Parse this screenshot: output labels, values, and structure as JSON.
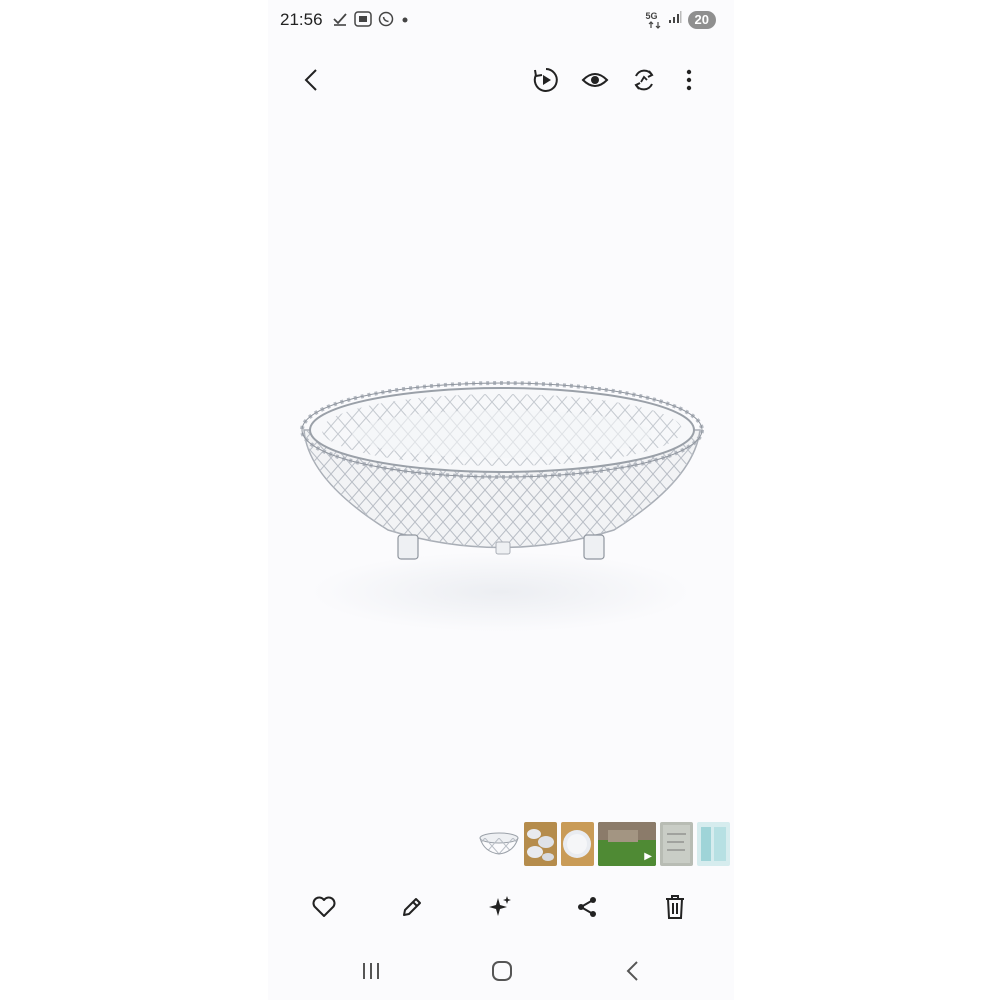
{
  "status_bar": {
    "time": "21:56",
    "network": "5G",
    "battery": "20",
    "icons": [
      "check-icon",
      "screenshot-icon",
      "whatsapp-icon",
      "dot-icon",
      "network-5g-icon",
      "signal-icon",
      "battery-icon"
    ]
  },
  "toolbar": {
    "icons": [
      "back-icon",
      "play-motion-icon",
      "eye-icon",
      "remaster-icon",
      "more-icon"
    ]
  },
  "photo": {
    "subject": "crystal-glass-bowl"
  },
  "thumbnails": {
    "count": 6,
    "video_index": 3
  },
  "actions": {
    "icons": [
      "heart-icon",
      "edit-icon",
      "sparkle-icon",
      "share-icon",
      "delete-icon"
    ]
  },
  "navbar": {
    "icons": [
      "recents-icon",
      "home-icon",
      "nav-back-icon"
    ]
  },
  "colors": {
    "background": "#fbfbfd",
    "icon": "#222222",
    "battery_badge": "#8f8f8f"
  }
}
